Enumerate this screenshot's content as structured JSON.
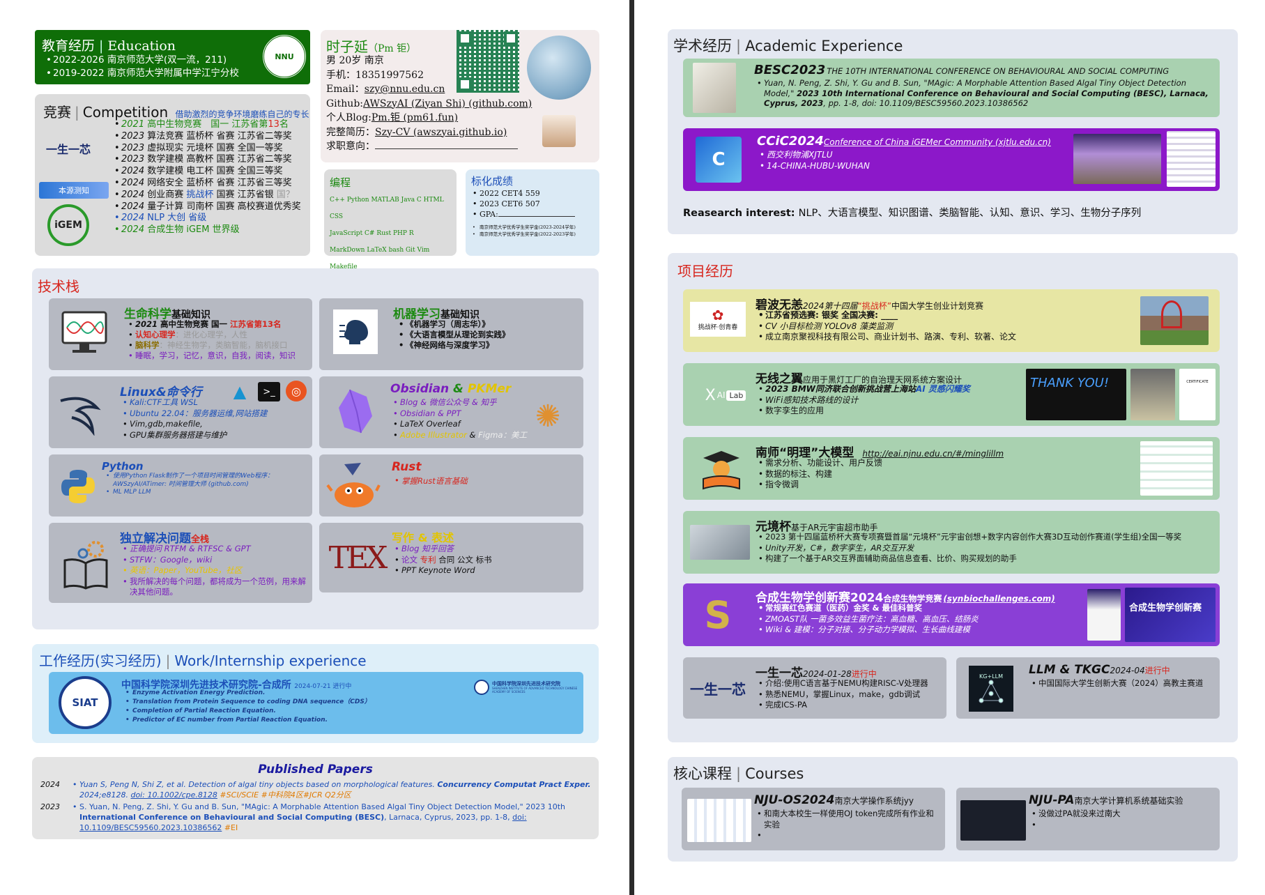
{
  "left": {
    "edu": {
      "title": "教育经历",
      "title_en": "Education",
      "items": [
        "2022-2026 南京师范大学(双一流，211)",
        "2019-2022 南京师范大学附属中学江宁分校"
      ],
      "logo_text": "NNU"
    },
    "profile": {
      "name": "时子延",
      "nick": "（Pm 钜）",
      "line1": "男 20岁 南京",
      "phone": "手机：18351997562",
      "email_label": "Email：",
      "email": "szy@nnu.edu.cn",
      "github_label": "Github:",
      "github": "AWSzyAI (Ziyan Shi) (github.com)",
      "blog_label": "个人Blog:",
      "blog": "Pm.钜 (pm61.fun)",
      "cv_label": "完整简历：",
      "cv": "Szy-CV (awszyai.github.io)",
      "job_label": "求职意向："
    },
    "comp": {
      "title": "竞赛",
      "title_en": "Competition",
      "slogan": "借助激烈的竞争环境磨练自己的专长",
      "items": [
        {
          "year": "2021",
          "a": " 高中生物竞赛",
          "b": "国一 江苏省第",
          "c": "13",
          "d": "名"
        },
        {
          "year": "2023",
          "a": " 算法竞赛 蓝桥杯 省赛 江苏省二等奖"
        },
        {
          "year": "2023",
          "a": " 虚拟现实 元境杯 国赛 全国一等奖"
        },
        {
          "year": "2023",
          "a": " 数学建模 高教杯 国赛 江苏省二等奖"
        },
        {
          "year": "2024",
          "a": " 数学建模 电工杯 国赛 全国三等奖"
        },
        {
          "year": "2024",
          "a": " 网络安全 蓝桥杯 省赛 江苏省三等奖"
        },
        {
          "year": "2024",
          "a": " 创业商赛 ",
          "b": "挑战杯",
          "c": " 国赛 江苏省银 ",
          "d": "国？"
        },
        {
          "year": "2024",
          "a": " 量子计算 司南杯 国赛 高校赛道优秀奖"
        },
        {
          "year": "2024",
          "a": " NLP      大创  省级"
        },
        {
          "year": "2024",
          "a": " 合成生物 iGEM 世界级"
        }
      ],
      "logo1": "一生一芯",
      "logo2": "本源测知",
      "logo3": "iGEM"
    },
    "prog": {
      "title": "编程",
      "lines": [
        "C++ Python MATLAB Java C HTML CSS",
        "JavaScript C# Rust PHP R",
        "MarkDown LaTeX bash Git Vim Makefile"
      ]
    },
    "scores": {
      "title": "标化成绩",
      "items": [
        "2022 CET4 559",
        "2023 CET6 507",
        "GPA:"
      ],
      "notes": [
        "南京师范大学优秀学生奖学金(2023-2024学年)",
        "南京师范大学优秀学生奖学金(2022-2023学年)"
      ]
    },
    "tech": {
      "title": "技术栈",
      "bio": {
        "title": "生命科学",
        "suffix": "基础知识",
        "l1a": "2021",
        "l1b": " 高中生物竞赛   国一 ",
        "l1c": "江苏省第13名",
        "l2a": "认知心理学",
        "l2b": "：进化心理学，人性",
        "l3a": "脑科学",
        "l3b": "：神经生物学，类脑智能，脑机接口",
        "l4": "睡眠，学习，记忆，意识，自我，阅读，知识"
      },
      "ml": {
        "title": "机器学习",
        "suffix": "基础知识",
        "items": [
          "《机器学习（周志华）》",
          "《大语言模型从理论到实践》",
          "《神经网络与深度学习》"
        ]
      },
      "linux": {
        "title": "Linux&命令行",
        "items": [
          "Kali:CTF工具  WSL",
          "Ubuntu 22.04：服务器运维,网站搭建",
          "Vim,gdb,makefile,",
          "GPU集群服务器搭建与维护"
        ],
        "arch": "arch"
      },
      "obs": {
        "t1": "Obsidian",
        "amp": " & ",
        "t2": "PKMer",
        "l1": "Blog & 微信公众号 & 知乎",
        "l2": "Obsidian & PPT",
        "l3": "LaTeX Overleaf",
        "l4a": "Adobe Illustrator",
        "l4b": " & ",
        "l4c": "Figma：美工"
      },
      "py": {
        "title": "Python",
        "l1": "使用Python Flask制作了一个项目时间管理的Web程序：AWSzyAI/ATimer: 时间管理大师 (github.com)",
        "l2": "ML MLP LLM"
      },
      "rust": {
        "title": "Rust",
        "l1": "掌握Rust语言基础"
      },
      "solve": {
        "title": "独立解决问题",
        "suffix": "全栈",
        "l1": "正确提问 RTFM & RTFSC & GPT",
        "l2": "STFW：Google，wiki",
        "l3": "英语：Paper，YouTube，社区",
        "l4": "我所解决的每个问题，都将成为一个范例，用来解决其他问题。"
      },
      "write": {
        "title": "写作 & 表述",
        "l1": "Blog 知乎回答",
        "l2a": "论文 ",
        "l2b": "专利",
        "l2c": " 合同 公文 标书",
        "l3": "PPT Keynote Word",
        "logo": "TEX"
      }
    },
    "work": {
      "title": "工作经历(实习经历)",
      "title_en": "Work/Internship experience",
      "org": "中国科学院深圳先进技术研究院-合成所",
      "date": "2024-07-21 进行中",
      "items": [
        "Enzyme Activation Energy Prediction.",
        "Translation from Protein Sequence to coding DNA sequence（CDS）",
        "Completion of Partial Reaction Equation.",
        "Predictor of EC number from Partial Reaction Equation."
      ],
      "logo": "SIAT",
      "inst_cn": "中国科学院深圳先进技术研究院",
      "inst_en": "SHENZHEN INSTITUTE OF ADVANCED TECHNOLOGY CHINESE ACADEMY OF SCIENCES"
    },
    "papers": {
      "title": "Published Papers",
      "p1": {
        "year": "2024",
        "text": "Yuan S,  Peng N,  Shi Z, et al.  Detection of algal tiny objects based on morphological features. ",
        "journal": "Concurrency Computat Pract Exper.",
        "rest": " 2024;e8128. ",
        "doi": "doi: 10.1002/cpe.8128",
        "tag": " #SCI/SCIE #中科院4区#JCR Q2分区"
      },
      "p2": {
        "year": "2023",
        "text": "S. Yuan, N. Peng, Z. Shi, Y. Gu and B. Sun, \"MAgic: A Morphable Attention Based Algal Tiny Object Detection Model,\" 2023 10th ",
        "conf": "International Conference on Behavioural and Social Computing (BESC)",
        "rest": ", Larnaca, Cyprus, 2023, pp. 1-8, ",
        "doi": "doi: 10.1109/BESC59560.2023.10386562",
        "tag": " #EI"
      }
    }
  },
  "right": {
    "acad": {
      "title": "学术经历",
      "title_en": "Academic Experience",
      "besc": {
        "name": "BESC2023",
        "conf": "THE 10TH INTERNATIONAL CONFERENCE ON BEHAVIOURAL AND SOCIAL COMPUTING",
        "t1": "Yuan, N. Peng, Z. Shi, Y. Gu and B. Sun, \"MAgic: A Morphable Attention Based Algal Tiny Object Detection Model,\" ",
        "t2": "2023 10th International Conference on Behavioural and Social Computing (BESC), Larnaca, Cyprus, 2023",
        "t3": ", pp. 1-8, doi: 10.1109/BESC59560.2023.10386562"
      },
      "ccic": {
        "name": "CCiC2024",
        "link": "Conference of China iGEMer Community (xjtlu.edu.cn)",
        "items": [
          "西交利物浦XJTLU",
          "14-CHINA-HUBU-WUHAN"
        ]
      },
      "interest_label": "Reasearch interest: ",
      "interest": "NLP、大语言模型、知识图谱、类脑智能、认知、意识、学习、生物分子序列"
    },
    "proj": {
      "title": "项目经历",
      "bibo": {
        "name": "碧波无恙",
        "sub1": "2024第十四届",
        "sub2": "“挑战杯”",
        "sub3": "中国大学生创业计划竞赛",
        "l1": "江苏省预选赛: 银奖 全国决赛: ____",
        "l2": "CV 小目标检测 YOLOv8 藻类监测",
        "l3": "成立南京聚视科技有限公司、商业计划书、路演、专利、软著、论文",
        "logo": "挑战杯·创青春"
      },
      "wing": {
        "name": "无线之翼",
        "sub": "应用于黑灯工厂的自治理天网系统方案设计",
        "l1a": "2023 BMW同济联合创新挑战营上海站",
        "l1b": "AI 灵感闪耀奖",
        "l2": "WiFi感知技术路线的设计",
        "l3": "数字孪生的应用",
        "logo1": "X",
        "logo2": "AI",
        "logo3": "Lab",
        "thank": "THANK YOU!",
        "cert": "CERTIFICATE"
      },
      "ming": {
        "name": "南师“明理”大模型",
        "link": "http://eai.njnu.edu.cn/#/minglillm",
        "items": [
          "需求分析、功能设计、用户反馈",
          "数据的标注、构建",
          "指令微调"
        ]
      },
      "yjb": {
        "name": "元境杯",
        "sub": "基于AR元宇宙超市助手",
        "items": [
          "2023 第十四届蓝桥杯大赛专项赛暨首届“元境杯”元宇宙创想+数字内容创作大赛3D互动创作赛道(学生组)全国一等奖",
          "Unity开发，C#，数字孪生，AR交互开发",
          "构建了一个基于AR交互界面辅助商品信息查看、比价、购买规划的助手"
        ]
      },
      "syn": {
        "name": "合成生物学创新赛2024",
        "sub": "合成生物学竞赛",
        "link": "(synbiochallenges.com)",
        "items": [
          "常规赛红色赛道（医药）金奖 & 最佳科普奖",
          "ZMOAST队 一菌多效益生菌疗法：高血糖、高血压、结肠炎",
          "Wiki & 建模：分子对接、分子动力学模拟、生长曲线建模"
        ],
        "poster": "合成生物学创新赛"
      },
      "ysyx": {
        "name": "一生一芯",
        "date": "2024-01-28",
        "status": "进行中",
        "items": [
          "介绍:使用C语言基于NEMU构建RISC-V处理器",
          "熟悉NEMU，掌握Linux，make，gdb调试",
          "完成ICS-PA"
        ],
        "logo": "一生一芯"
      },
      "llm": {
        "name": "LLM & TKGC",
        "date": "2024-04",
        "status": "进行中",
        "items": [
          "中国国际大学生创新大赛（2024）高教主赛道"
        ],
        "logo": "KG+LLM"
      }
    },
    "courses": {
      "title": "核心课程",
      "title_en": "Courses",
      "os": {
        "name": "NJU-OS2024",
        "sub": "南京大学操作系统jyy",
        "items": [
          "和南大本校生一样使用OJ token完成所有作业和实验",
          ""
        ]
      },
      "pa": {
        "name": "NJU-PA",
        "sub": "南京大学计算机系统基础实验",
        "items": [
          "没做过PA就没来过南大",
          ""
        ]
      }
    }
  }
}
